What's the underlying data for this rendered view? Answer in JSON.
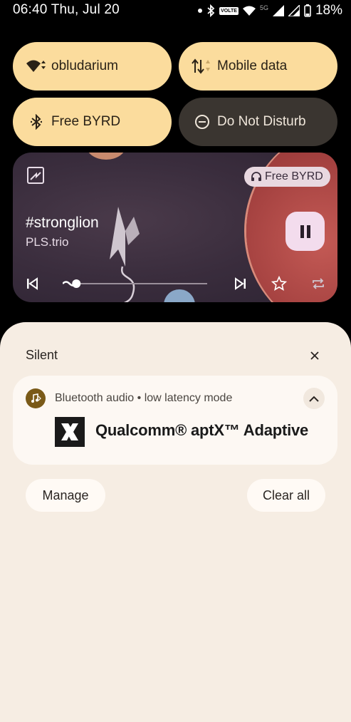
{
  "status_bar": {
    "time": "06:40",
    "date": "Thu, Jul 20",
    "volte_label": "VOLTE",
    "network_type": "5G",
    "battery": "18%"
  },
  "quick_tiles": [
    {
      "label": "obludarium",
      "icon": "wifi-icon",
      "state": "on"
    },
    {
      "label": "Mobile data",
      "icon": "mobile-data-icon",
      "state": "on"
    },
    {
      "label": "Free BYRD",
      "icon": "bluetooth-icon",
      "state": "on"
    },
    {
      "label": "Do Not Disturb",
      "icon": "dnd-icon",
      "state": "off"
    }
  ],
  "media": {
    "title": "#stronglion",
    "artist": "PLS.trio",
    "output_device": "Free BYRD",
    "state": "playing",
    "progress": 0.05
  },
  "notifications": {
    "section_title": "Silent",
    "card": {
      "app_name": "Bluetooth audio",
      "separator": "•",
      "subtitle": "low latency mode",
      "brand_text": "Qualcomm® aptX™ Adaptive"
    },
    "manage_label": "Manage",
    "clear_label": "Clear all"
  },
  "colors": {
    "tile_on": "#fbdc9d",
    "tile_off": "#3a3530",
    "shade_bg": "#f6ede3",
    "card_bg": "#fdf8f3",
    "pause_bg": "#f3dced"
  }
}
